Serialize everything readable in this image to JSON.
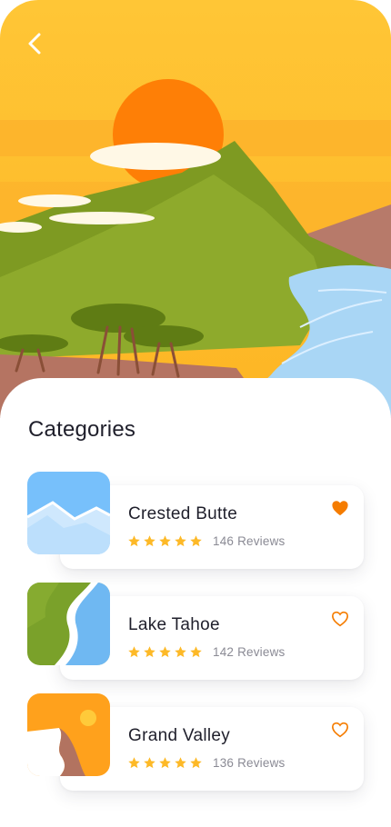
{
  "header": {
    "back_icon": "chevron-left-icon"
  },
  "section": {
    "title": "Categories"
  },
  "colors": {
    "accent": "#f57c00",
    "star": "#fdb927",
    "sky": "#fec331"
  },
  "places": [
    {
      "name": "Crested Butte",
      "rating": 5,
      "reviews": "146 Reviews",
      "favorite": true,
      "thumb_icon": "snowy-mountain-icon"
    },
    {
      "name": "Lake Tahoe",
      "rating": 5,
      "reviews": "142 Reviews",
      "favorite": false,
      "thumb_icon": "river-icon"
    },
    {
      "name": "Grand Valley",
      "rating": 5,
      "reviews": "136 Reviews",
      "favorite": false,
      "thumb_icon": "canyon-sun-icon"
    }
  ]
}
